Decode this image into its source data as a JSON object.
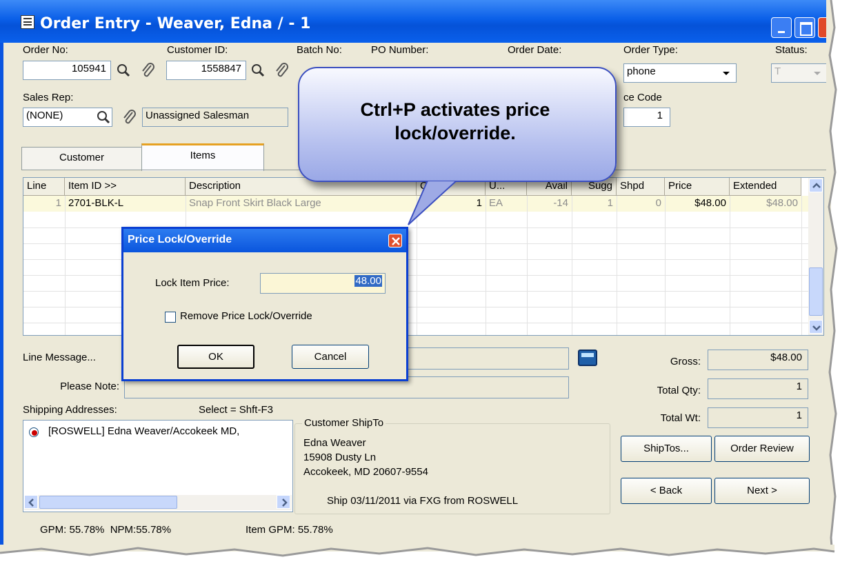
{
  "window": {
    "title": "Order Entry - Weaver, Edna / - 1"
  },
  "header": {
    "order_no_label": "Order No:",
    "order_no": "105941",
    "customer_id_label": "Customer ID:",
    "customer_id": "1558847",
    "batch_no_label": "Batch No:",
    "po_number_label": "PO Number:",
    "order_date_label": "Order Date:",
    "order_type_label": "Order Type:",
    "order_type": "phone",
    "status_label": "Status:",
    "status": "T",
    "sales_rep_label": "Sales Rep:",
    "sales_rep": "(NONE)",
    "sales_rep_name": "Unassigned Salesman",
    "price_code_label": "ce Code",
    "price_code": "1"
  },
  "tabs": [
    "Customer",
    "Items"
  ],
  "grid": {
    "columns": [
      "Line",
      "Item ID >>",
      "Description",
      "Q...",
      "U...",
      "Avail",
      "Sugg",
      "Shpd",
      "Price",
      "Extended"
    ],
    "row": {
      "line": "1",
      "item_id": "2701-BLK-L",
      "description": "Snap Front Skirt Black Large",
      "qty": "1",
      "unit": "EA",
      "avail": "-14",
      "sugg": "1",
      "shpd": "0",
      "price": "$48.00",
      "extended": "$48.00"
    }
  },
  "callout": {
    "text": "Ctrl+P activates price lock/override."
  },
  "dialog": {
    "title": "Price Lock/Override",
    "lock_label": "Lock Item Price:",
    "lock_value": "48.00",
    "remove_label": "Remove Price Lock/Override",
    "ok": "OK",
    "cancel": "Cancel"
  },
  "bottom": {
    "line_message": "Line Message...",
    "please_note": "Please Note:",
    "shipping_addresses": "Shipping Addresses:",
    "select_hint": "Select = Shft-F3",
    "address_item": "[ROSWELL] Edna Weaver/Accokeek MD,",
    "shipto_group": "Customer ShipTo",
    "shipto_name": "Edna Weaver",
    "shipto_street": "15908 Dusty Ln",
    "shipto_city": "Accokeek, MD 20607-9554",
    "ship_info": "Ship 03/11/2011 via FXG from ROSWELL",
    "gpm": "GPM: 55.78%  NPM:55.78%",
    "item_gpm": "Item GPM: 55.78%"
  },
  "totals": {
    "gross_label": "Gross:",
    "gross": "$48.00",
    "qty_label": "Total Qty:",
    "qty": "1",
    "wt_label": "Total Wt:",
    "wt": "1"
  },
  "buttons": {
    "shiptos": "ShipTos...",
    "order_review": "Order Review",
    "back": "< Back",
    "next": "Next >"
  }
}
